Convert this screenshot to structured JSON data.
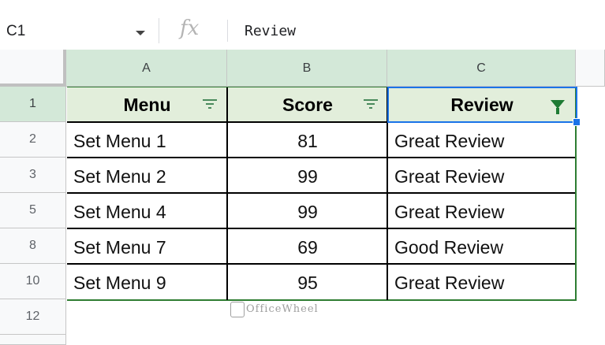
{
  "formula_bar": {
    "name_box": "C1",
    "fx_label": "fx",
    "value": "Review"
  },
  "columns": [
    "A",
    "B",
    "C"
  ],
  "rows": [
    {
      "num": "1",
      "cells": [
        "Menu",
        "Score",
        "Review"
      ]
    },
    {
      "num": "2",
      "cells": [
        "Set Menu 1",
        "81",
        "Great Review"
      ]
    },
    {
      "num": "3",
      "cells": [
        "Set Menu 2",
        "99",
        "Great Review"
      ]
    },
    {
      "num": "5",
      "cells": [
        "Set Menu 4",
        "99",
        "Great Review"
      ]
    },
    {
      "num": "8",
      "cells": [
        "Set Menu 7",
        "69",
        "Good Review"
      ]
    },
    {
      "num": "10",
      "cells": [
        "Set Menu 9",
        "95",
        "Great Review"
      ]
    },
    {
      "num": "12",
      "cells": [
        "",
        "",
        ""
      ]
    }
  ],
  "watermark": "OfficeWheel",
  "colors": {
    "header_fill": "#e2eedb",
    "column_header_fill": "#d3e8d8",
    "selection": "#1a73e8",
    "filter_active": "#1e7b34"
  }
}
